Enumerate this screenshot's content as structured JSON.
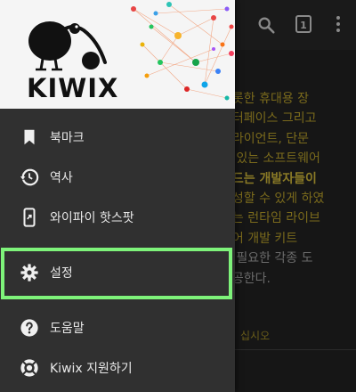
{
  "toolbar": {
    "tab_count": "1",
    "icons": [
      "search-icon",
      "tabs-icon",
      "more-icon"
    ]
  },
  "background": {
    "partial_number": "0"
  },
  "article": {
    "lines": [
      "비롯한 휴대용 장",
      "인터페이스 그리고",
      "클라이언트, 단문",
      "고 있는 소프트웨어",
      "이드는 개발자들이",
      "작성할 수 있게 하였",
      "있는 런타임 라이브",
      "웨어 개발 키트",
      "데 필요한 각종 도",
      "제공한다."
    ],
    "footnote": "십시오"
  },
  "drawer": {
    "logo_text": "KIWIX",
    "items": [
      {
        "label": "북마크",
        "icon": "bookmark-icon"
      },
      {
        "label": "역사",
        "icon": "history-icon"
      },
      {
        "label": "와이파이 핫스팟",
        "icon": "hotspot-icon"
      },
      {
        "label": "설정",
        "icon": "settings-icon"
      },
      {
        "label": "도움말",
        "icon": "help-icon"
      },
      {
        "label": "Kiwix 지원하기",
        "icon": "support-icon"
      }
    ]
  },
  "colors": {
    "highlight": "#7ef37a",
    "drawer_bg": "#303030",
    "article_link": "#7a6a1c"
  }
}
